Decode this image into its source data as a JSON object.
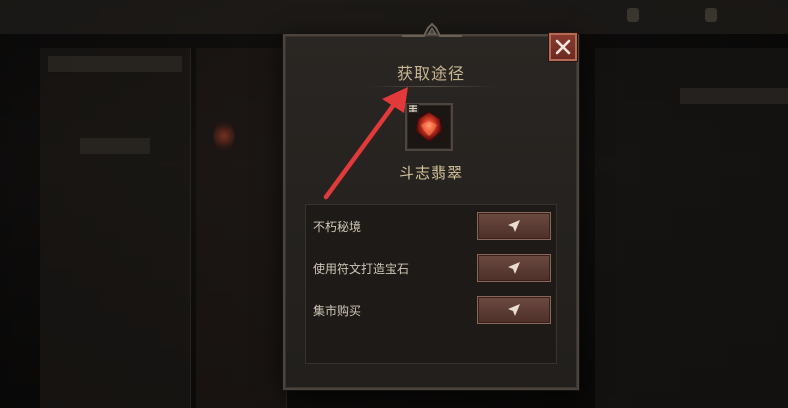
{
  "dialog": {
    "title": "获取途径",
    "item_name": "斗志翡翠",
    "close_icon": "close-icon"
  },
  "sources": [
    {
      "label": "不朽秘境",
      "button_icon": "navigate-arrow-icon"
    },
    {
      "label": "使用符文打造宝石",
      "button_icon": "navigate-arrow-icon"
    },
    {
      "label": "集市购买",
      "button_icon": "navigate-arrow-icon"
    }
  ],
  "colors": {
    "title": "#c9b793",
    "item_name": "#d8c79e",
    "close_button": "#8a3a2e",
    "go_button": "#6b4a40",
    "annotation_arrow": "#e23a3a"
  }
}
